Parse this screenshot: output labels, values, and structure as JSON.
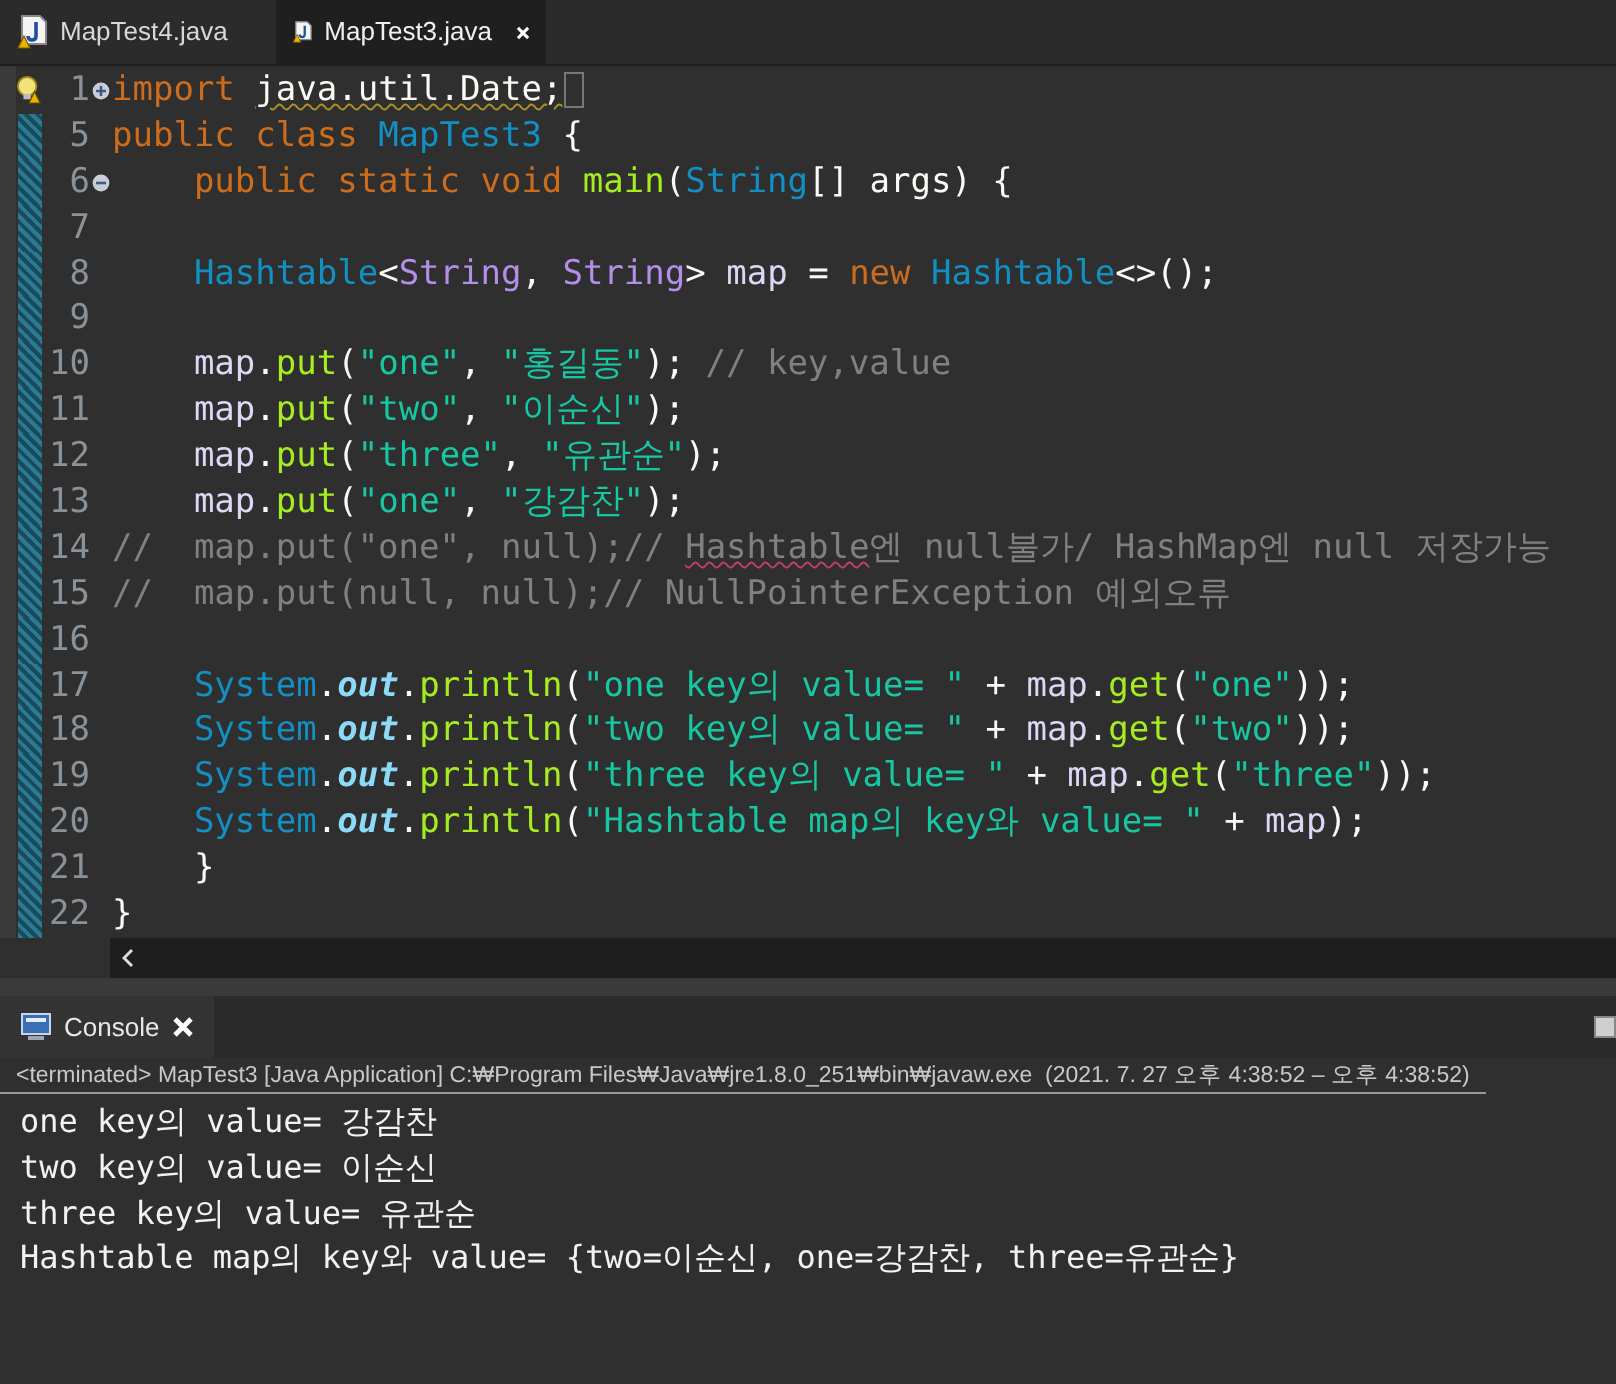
{
  "editor_tabs": [
    {
      "label": "MapTest4.java",
      "selected": false
    },
    {
      "label": "MapTest3.java",
      "selected": true
    }
  ],
  "code_lines": [
    {
      "number": "1",
      "collapsed": true,
      "warning": true,
      "tokens": [
        {
          "kind": "keyword",
          "text": "import "
        },
        {
          "kind": "plain",
          "text": "java.util.Date;",
          "warn": true
        }
      ]
    },
    {
      "number": "5",
      "changed": true,
      "tokens": [
        {
          "kind": "keyword",
          "text": "public class "
        },
        {
          "kind": "type",
          "text": "MapTest3"
        },
        {
          "kind": "plain",
          "text": " {"
        }
      ]
    },
    {
      "number": "6",
      "collapsed": false,
      "changed": true,
      "tokens": [
        {
          "kind": "keyword",
          "text": "    public static void "
        },
        {
          "kind": "method",
          "text": "main"
        },
        {
          "kind": "plain",
          "text": "("
        },
        {
          "kind": "type",
          "text": "String"
        },
        {
          "kind": "plain",
          "text": "[] args) {"
        }
      ]
    },
    {
      "number": "7",
      "changed": true
    },
    {
      "number": "8",
      "changed": true,
      "tokens": [
        {
          "kind": "type",
          "text": "    Hashtable"
        },
        {
          "kind": "plain",
          "text": "<"
        },
        {
          "kind": "typeparam",
          "text": "String"
        },
        {
          "kind": "plain",
          "text": ", "
        },
        {
          "kind": "typeparam",
          "text": "String"
        },
        {
          "kind": "plain",
          "text": "> "
        },
        {
          "kind": "var",
          "text": "map"
        },
        {
          "kind": "plain",
          "text": " = "
        },
        {
          "kind": "keyword",
          "text": "new "
        },
        {
          "kind": "type",
          "text": "Hashtable"
        },
        {
          "kind": "plain",
          "text": "<>();"
        }
      ]
    },
    {
      "number": "9",
      "changed": true
    },
    {
      "number": "10",
      "changed": true,
      "tokens": [
        {
          "kind": "var",
          "text": "    map"
        },
        {
          "kind": "plain",
          "text": "."
        },
        {
          "kind": "method",
          "text": "put"
        },
        {
          "kind": "plain",
          "text": "("
        },
        {
          "kind": "string",
          "text": "\"one\""
        },
        {
          "kind": "plain",
          "text": ", "
        },
        {
          "kind": "string",
          "text": "\"홍길동\""
        },
        {
          "kind": "plain",
          "text": "); "
        },
        {
          "kind": "comment",
          "text": "// key,value"
        }
      ]
    },
    {
      "number": "11",
      "changed": true,
      "tokens": [
        {
          "kind": "var",
          "text": "    map"
        },
        {
          "kind": "plain",
          "text": "."
        },
        {
          "kind": "method",
          "text": "put"
        },
        {
          "kind": "plain",
          "text": "("
        },
        {
          "kind": "string",
          "text": "\"two\""
        },
        {
          "kind": "plain",
          "text": ", "
        },
        {
          "kind": "string",
          "text": "\"이순신\""
        },
        {
          "kind": "plain",
          "text": ");"
        }
      ]
    },
    {
      "number": "12",
      "changed": true,
      "tokens": [
        {
          "kind": "var",
          "text": "    map"
        },
        {
          "kind": "plain",
          "text": "."
        },
        {
          "kind": "method",
          "text": "put"
        },
        {
          "kind": "plain",
          "text": "("
        },
        {
          "kind": "string",
          "text": "\"three\""
        },
        {
          "kind": "plain",
          "text": ", "
        },
        {
          "kind": "string",
          "text": "\"유관순\""
        },
        {
          "kind": "plain",
          "text": ");"
        }
      ]
    },
    {
      "number": "13",
      "changed": true,
      "tokens": [
        {
          "kind": "var",
          "text": "    map"
        },
        {
          "kind": "plain",
          "text": "."
        },
        {
          "kind": "method",
          "text": "put"
        },
        {
          "kind": "plain",
          "text": "("
        },
        {
          "kind": "string",
          "text": "\"one\""
        },
        {
          "kind": "plain",
          "text": ", "
        },
        {
          "kind": "string",
          "text": "\"강감찬\""
        },
        {
          "kind": "plain",
          "text": ");"
        }
      ]
    },
    {
      "number": "14",
      "changed": true,
      "tokens": [
        {
          "kind": "comment",
          "text": "//  map.put(\"one\", null);// "
        },
        {
          "kind": "comment",
          "text": "Hashtable",
          "squiggle": true
        },
        {
          "kind": "comment",
          "text": "엔 null불가/ HashMap엔 null 저장가능"
        }
      ]
    },
    {
      "number": "15",
      "changed": true,
      "tokens": [
        {
          "kind": "comment",
          "text": "//  map.put(null, null);// NullPointerException 예외오류"
        }
      ]
    },
    {
      "number": "16",
      "changed": true
    },
    {
      "number": "17",
      "changed": true,
      "tokens": [
        {
          "kind": "type",
          "text": "    System"
        },
        {
          "kind": "plain",
          "text": "."
        },
        {
          "kind": "field",
          "text": "out"
        },
        {
          "kind": "plain",
          "text": "."
        },
        {
          "kind": "method",
          "text": "println"
        },
        {
          "kind": "plain",
          "text": "("
        },
        {
          "kind": "string",
          "text": "\"one key의 value= \""
        },
        {
          "kind": "plain",
          "text": " + "
        },
        {
          "kind": "var",
          "text": "map"
        },
        {
          "kind": "plain",
          "text": "."
        },
        {
          "kind": "method",
          "text": "get"
        },
        {
          "kind": "plain",
          "text": "("
        },
        {
          "kind": "string",
          "text": "\"one\""
        },
        {
          "kind": "plain",
          "text": "));"
        }
      ]
    },
    {
      "number": "18",
      "changed": true,
      "tokens": [
        {
          "kind": "type",
          "text": "    System"
        },
        {
          "kind": "plain",
          "text": "."
        },
        {
          "kind": "field",
          "text": "out"
        },
        {
          "kind": "plain",
          "text": "."
        },
        {
          "kind": "method",
          "text": "println"
        },
        {
          "kind": "plain",
          "text": "("
        },
        {
          "kind": "string",
          "text": "\"two key의 value= \""
        },
        {
          "kind": "plain",
          "text": " + "
        },
        {
          "kind": "var",
          "text": "map"
        },
        {
          "kind": "plain",
          "text": "."
        },
        {
          "kind": "method",
          "text": "get"
        },
        {
          "kind": "plain",
          "text": "("
        },
        {
          "kind": "string",
          "text": "\"two\""
        },
        {
          "kind": "plain",
          "text": "));"
        }
      ]
    },
    {
      "number": "19",
      "changed": true,
      "tokens": [
        {
          "kind": "type",
          "text": "    System"
        },
        {
          "kind": "plain",
          "text": "."
        },
        {
          "kind": "field",
          "text": "out"
        },
        {
          "kind": "plain",
          "text": "."
        },
        {
          "kind": "method",
          "text": "println"
        },
        {
          "kind": "plain",
          "text": "("
        },
        {
          "kind": "string",
          "text": "\"three key의 value= \""
        },
        {
          "kind": "plain",
          "text": " + "
        },
        {
          "kind": "var",
          "text": "map"
        },
        {
          "kind": "plain",
          "text": "."
        },
        {
          "kind": "method",
          "text": "get"
        },
        {
          "kind": "plain",
          "text": "("
        },
        {
          "kind": "string",
          "text": "\"three\""
        },
        {
          "kind": "plain",
          "text": "));"
        }
      ]
    },
    {
      "number": "20",
      "changed": true,
      "tokens": [
        {
          "kind": "type",
          "text": "    System"
        },
        {
          "kind": "plain",
          "text": "."
        },
        {
          "kind": "field",
          "text": "out"
        },
        {
          "kind": "plain",
          "text": "."
        },
        {
          "kind": "method",
          "text": "println"
        },
        {
          "kind": "plain",
          "text": "("
        },
        {
          "kind": "string",
          "text": "\"Hashtable map의 key와 value= \""
        },
        {
          "kind": "plain",
          "text": " + "
        },
        {
          "kind": "var",
          "text": "map"
        },
        {
          "kind": "plain",
          "text": ");"
        }
      ]
    },
    {
      "number": "21",
      "changed": true,
      "tokens": [
        {
          "kind": "plain",
          "text": "    }"
        }
      ]
    },
    {
      "number": "22",
      "changed": true,
      "tokens": [
        {
          "kind": "plain",
          "text": "}"
        }
      ]
    }
  ],
  "console": {
    "tab_label": "Console",
    "status": "<terminated> MapTest3 [Java Application] C:₩Program Files₩Java₩jre1.8.0_251₩bin₩javaw.exe  (2021. 7. 27 오후 4:38:52 – 오후 4:38:52)",
    "output": [
      "one key의 value= 강감찬",
      "two key의 value= 이순신",
      "three key의 value= 유관순",
      "Hashtable map의 key와 value= {two=이순신, one=강감찬, three=유관순}"
    ]
  }
}
